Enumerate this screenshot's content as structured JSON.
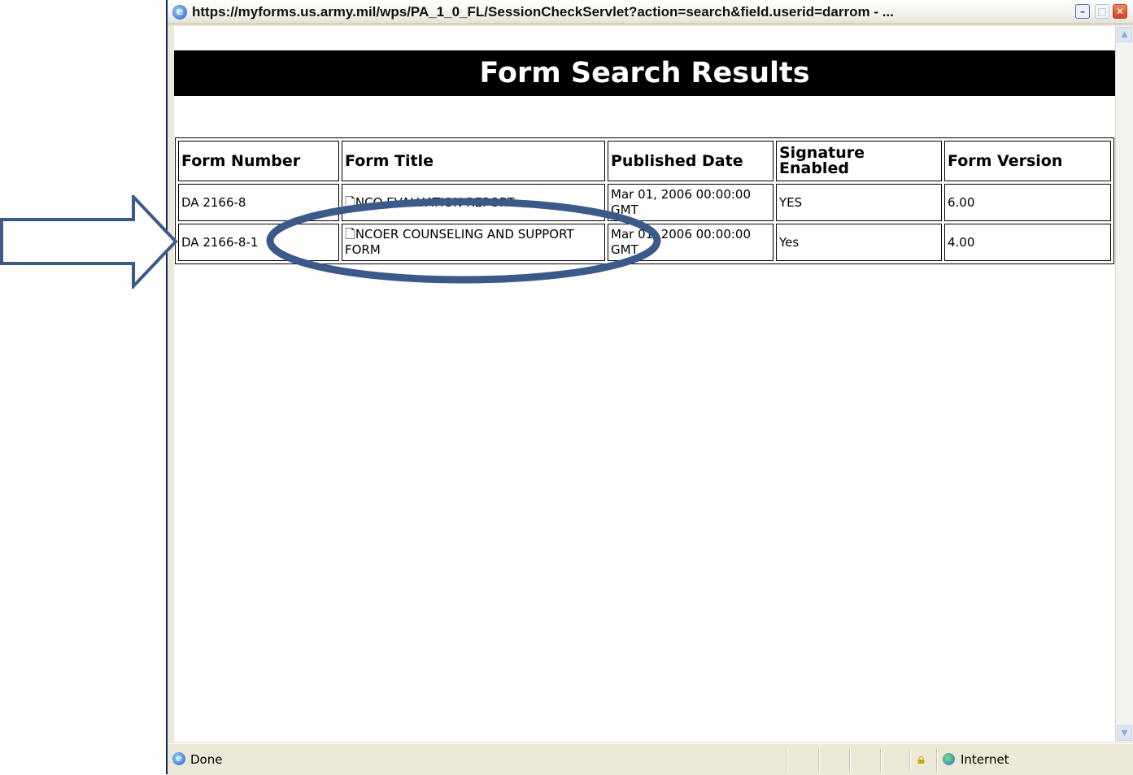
{
  "window": {
    "title": "https://myforms.us.army.mil/wps/PA_1_0_FL/SessionCheckServlet?action=search&field.userid=darrom - ...",
    "minimize_glyph": "–",
    "maximize_glyph": "□",
    "close_glyph": "✕"
  },
  "page": {
    "heading": "Form Search Results"
  },
  "table": {
    "headers": [
      "Form Number",
      "Form Title",
      "Published Date",
      "Signature Enabled",
      "Form Version"
    ],
    "rows": [
      {
        "form_number": "DA 2166-8",
        "form_title": "NCO EVALUATION REPORT",
        "published_date": "Mar 01, 2006 00:00:00 GMT",
        "signature_enabled": "YES",
        "form_version": "6.00"
      },
      {
        "form_number": "DA 2166-8-1",
        "form_title": "NCOER COUNSELING AND SUPPORT FORM",
        "published_date": "Mar 01, 2006 00:00:00 GMT",
        "signature_enabled": "Yes",
        "form_version": "4.00"
      }
    ]
  },
  "status": {
    "text": "Done",
    "zone": "Internet"
  },
  "annotation": {
    "color": "#3b5a8a"
  }
}
